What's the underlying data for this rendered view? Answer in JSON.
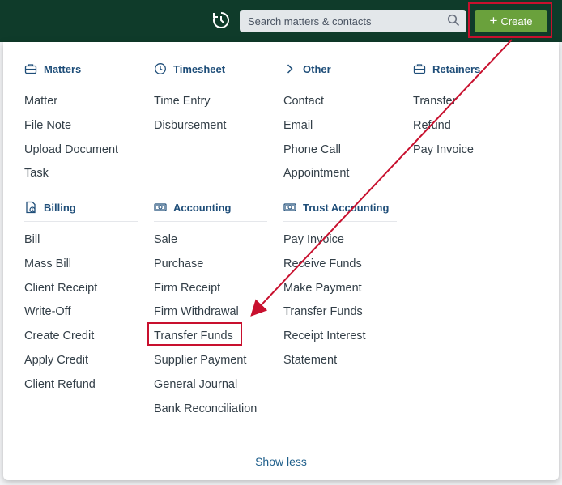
{
  "search": {
    "placeholder": "Search matters & contacts"
  },
  "create_button": {
    "label": "Create"
  },
  "sections": {
    "matters": {
      "title": "Matters",
      "items": [
        "Matter",
        "File Note",
        "Upload Document",
        "Task"
      ]
    },
    "timesheet": {
      "title": "Timesheet",
      "items": [
        "Time Entry",
        "Disbursement"
      ]
    },
    "other": {
      "title": "Other",
      "items": [
        "Contact",
        "Email",
        "Phone Call",
        "Appointment"
      ]
    },
    "retainers": {
      "title": "Retainers",
      "items": [
        "Transfer",
        "Refund",
        "Pay Invoice"
      ]
    },
    "billing": {
      "title": "Billing",
      "items": [
        "Bill",
        "Mass Bill",
        "Client Receipt",
        "Write-Off",
        "Create Credit",
        "Apply Credit",
        "Client Refund"
      ]
    },
    "accounting": {
      "title": "Accounting",
      "items": [
        "Sale",
        "Purchase",
        "Firm Receipt",
        "Firm Withdrawal",
        "Transfer Funds",
        "Supplier Payment",
        "General Journal",
        "Bank Reconciliation"
      ]
    },
    "trust_accounting": {
      "title": "Trust Accounting",
      "items": [
        "Pay Invoice",
        "Receive Funds",
        "Make Payment",
        "Transfer Funds",
        "Receipt Interest",
        "Statement"
      ]
    }
  },
  "show_less": "Show less",
  "colors": {
    "topbar": "#0f3b2a",
    "create": "#6aa13c",
    "highlight": "#c8102e",
    "heading": "#1f4e79"
  }
}
